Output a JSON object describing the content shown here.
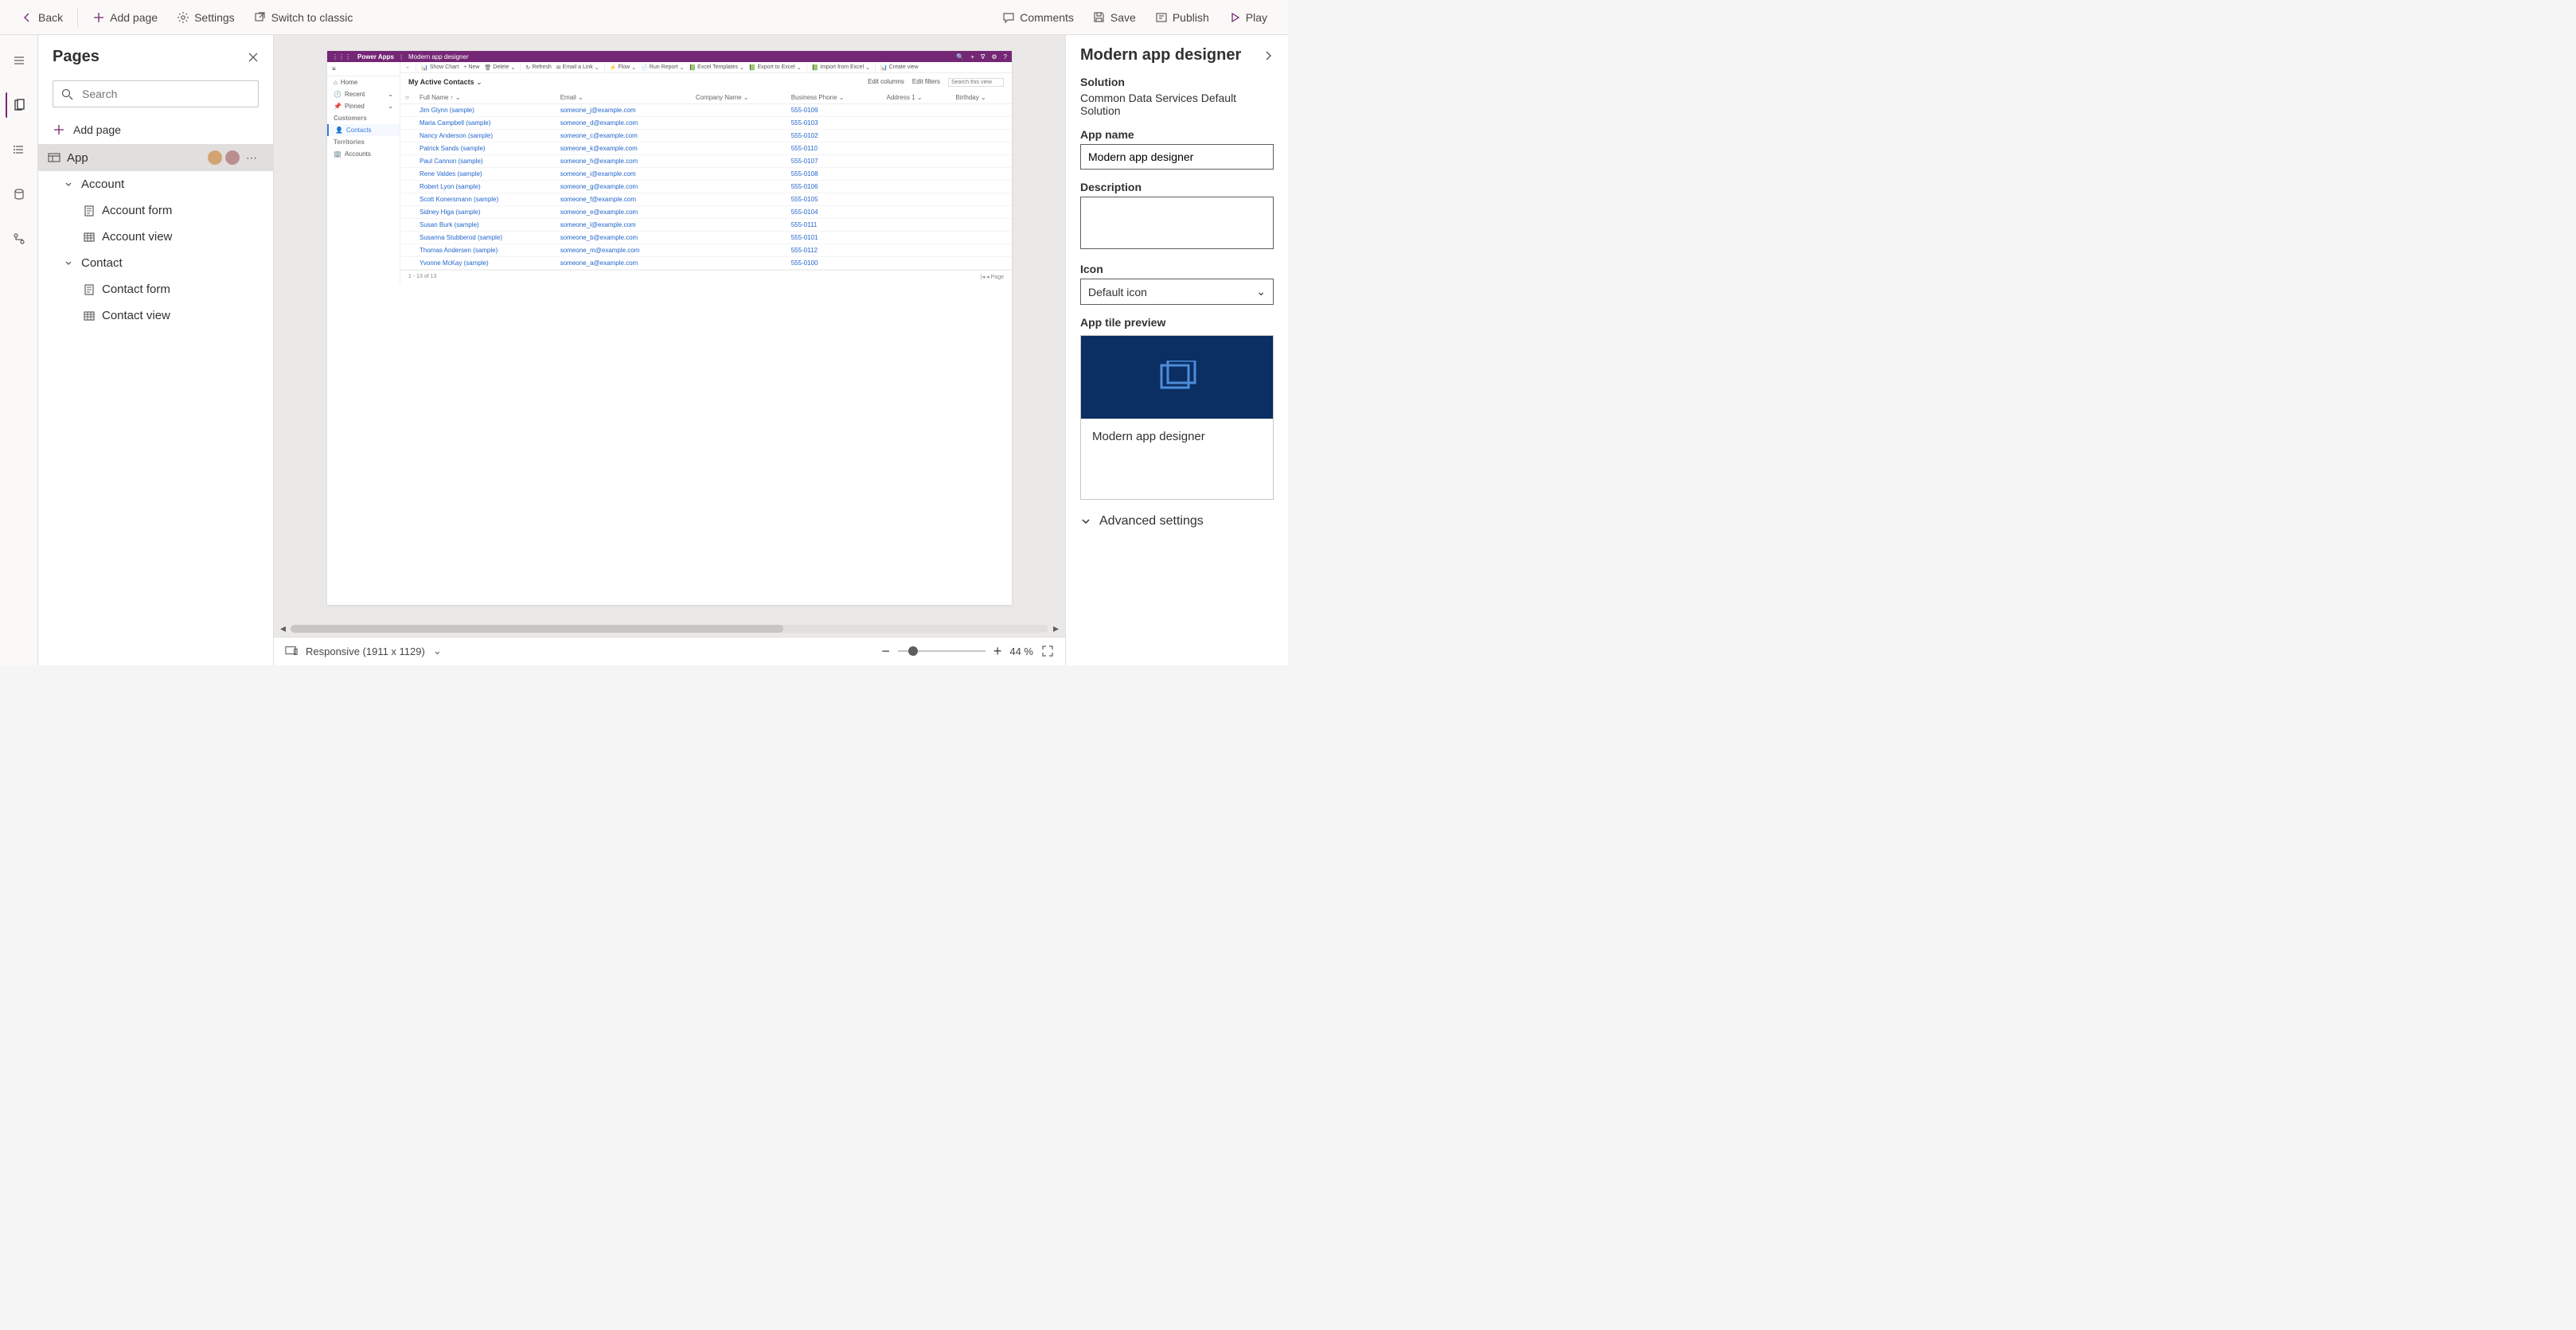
{
  "topbar": {
    "back": "Back",
    "add_page": "Add page",
    "settings": "Settings",
    "switch_classic": "Switch to classic",
    "comments": "Comments",
    "save": "Save",
    "publish": "Publish",
    "play": "Play"
  },
  "pages_panel": {
    "title": "Pages",
    "search_placeholder": "Search",
    "add_page": "Add page",
    "app_label": "App",
    "account": "Account",
    "account_form": "Account form",
    "account_view": "Account view",
    "contact": "Contact",
    "contact_form": "Contact form",
    "contact_view": "Contact view"
  },
  "preview": {
    "brand": "Power Apps",
    "app_name": "Modern app designer",
    "nav": {
      "home": "Home",
      "recent": "Recent",
      "pinned": "Pinned",
      "customers": "Customers",
      "contacts": "Contacts",
      "territories": "Territories",
      "accounts": "Accounts"
    },
    "cmdbar": {
      "show_chart": "Show Chart",
      "new": "New",
      "delete": "Delete",
      "refresh": "Refresh",
      "email_link": "Email a Link",
      "flow": "Flow",
      "run_report": "Run Report",
      "excel_templates": "Excel Templates",
      "export_excel": "Export to Excel",
      "import_excel": "Import from Excel",
      "create_view": "Create view"
    },
    "view_name": "My Active Contacts",
    "toolbar_right": {
      "edit_columns": "Edit columns",
      "edit_filters": "Edit filters",
      "search_placeholder": "Search this view"
    },
    "columns": [
      "Full Name",
      "Email",
      "Company Name",
      "Business Phone",
      "Address 1",
      "Birthday"
    ],
    "rows": [
      {
        "name": "Jim Glynn (sample)",
        "email": "someone_j@example.com",
        "phone": "555-0109"
      },
      {
        "name": "Maria Campbell (sample)",
        "email": "someone_d@example.com",
        "phone": "555-0103"
      },
      {
        "name": "Nancy Anderson (sample)",
        "email": "someone_c@example.com",
        "phone": "555-0102"
      },
      {
        "name": "Patrick Sands (sample)",
        "email": "someone_k@example.com",
        "phone": "555-0110"
      },
      {
        "name": "Paul Cannon (sample)",
        "email": "someone_h@example.com",
        "phone": "555-0107"
      },
      {
        "name": "Rene Valdes (sample)",
        "email": "someone_i@example.com",
        "phone": "555-0108"
      },
      {
        "name": "Robert Lyon (sample)",
        "email": "someone_g@example.com",
        "phone": "555-0106"
      },
      {
        "name": "Scott Konersmann (sample)",
        "email": "someone_f@example.com",
        "phone": "555-0105"
      },
      {
        "name": "Sidney Higa (sample)",
        "email": "someone_e@example.com",
        "phone": "555-0104"
      },
      {
        "name": "Susan Burk (sample)",
        "email": "someone_l@example.com",
        "phone": "555-0111"
      },
      {
        "name": "Susanna Stubberod (sample)",
        "email": "someone_b@example.com",
        "phone": "555-0101"
      },
      {
        "name": "Thomas Andersen (sample)",
        "email": "someone_m@example.com",
        "phone": "555-0112"
      },
      {
        "name": "Yvonne McKay (sample)",
        "email": "someone_a@example.com",
        "phone": "555-0100"
      }
    ],
    "footer_count": "1 - 13 of 13",
    "footer_page": "Page"
  },
  "status": {
    "responsive": "Responsive (1911 x 1129)",
    "zoom": "44 %"
  },
  "right_panel": {
    "title": "Modern app designer",
    "solution_label": "Solution",
    "solution_value": "Common Data Services Default Solution",
    "app_name_label": "App name",
    "app_name_value": "Modern app designer",
    "description_label": "Description",
    "icon_label": "Icon",
    "icon_value": "Default icon",
    "tile_preview_label": "App tile preview",
    "tile_name": "Modern app designer",
    "advanced": "Advanced settings"
  }
}
